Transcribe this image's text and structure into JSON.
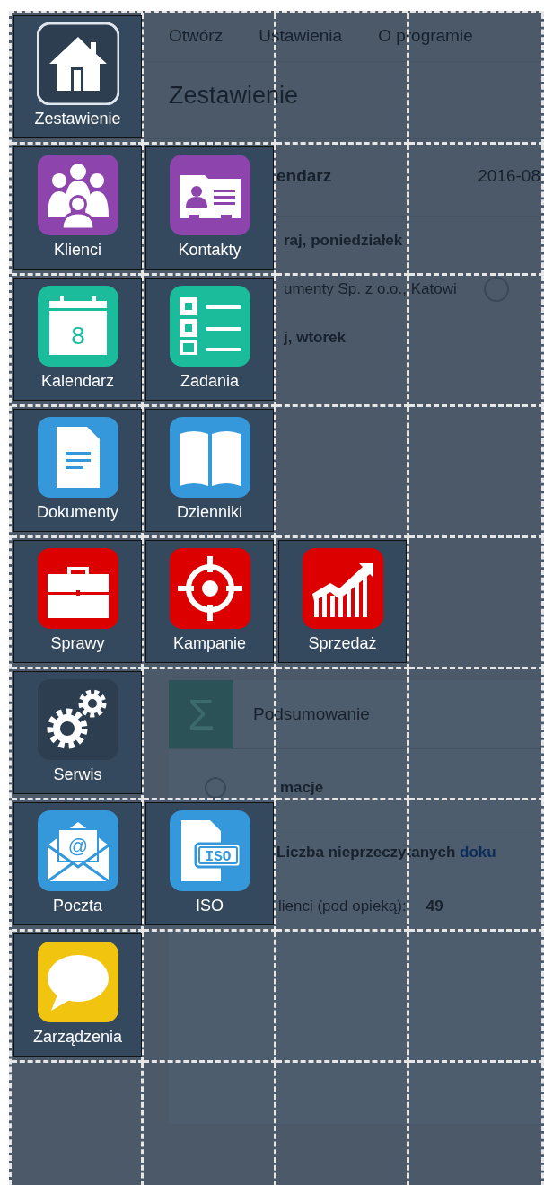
{
  "menu": [
    "Otwórz",
    "Ustawienia",
    "O programie"
  ],
  "page_title": "Zestawienie",
  "events": {
    "title": "endarz",
    "date": "2016-08",
    "items": [
      {
        "kind": "day",
        "text": "raj, poniedziałek"
      },
      {
        "kind": "entry",
        "text": "umenty Sp. z o.o., Katowi"
      },
      {
        "kind": "day",
        "text": "j, wtorek"
      }
    ]
  },
  "summary": {
    "icon": "Σ",
    "title": "Podsumowanie",
    "section": "macje",
    "unread_label": "Liczba nieprzeczytanych",
    "unread_link": "doku",
    "clients_label": "lienci (pod opieką):",
    "clients_value": "49"
  },
  "tile_rows": [
    [
      {
        "label": "Zestawienie",
        "kind": "home",
        "color": "#2c3e50"
      }
    ],
    [
      {
        "label": "Klienci",
        "kind": "people",
        "color": "#8e44ad"
      },
      {
        "label": "Kontakty",
        "kind": "contact",
        "color": "#8e44ad"
      }
    ],
    [
      {
        "label": "Kalendarz",
        "kind": "calendar",
        "color": "#1abc9c",
        "icon_text": "8"
      },
      {
        "label": "Zadania",
        "kind": "tasks",
        "color": "#1abc9c"
      }
    ],
    [
      {
        "label": "Dokumenty",
        "kind": "document",
        "color": "#3498db"
      },
      {
        "label": "Dzienniki",
        "kind": "book",
        "color": "#3498db"
      }
    ],
    [
      {
        "label": "Sprawy",
        "kind": "briefcase",
        "color": "#dd0000"
      },
      {
        "label": "Kampanie",
        "kind": "target",
        "color": "#dd0000"
      },
      {
        "label": "Sprzedaż",
        "kind": "chart",
        "color": "#dd0000"
      }
    ],
    [
      {
        "label": "Serwis",
        "kind": "gears",
        "color": "#2c3e50"
      }
    ],
    [
      {
        "label": "Poczta",
        "kind": "mail",
        "color": "#3498db",
        "icon_text": "@"
      },
      {
        "label": "ISO",
        "kind": "iso",
        "color": "#3498db",
        "icon_text": "ISO"
      }
    ],
    [
      {
        "label": "Zarządzenia",
        "kind": "bubble",
        "color": "#f1c40f"
      }
    ],
    []
  ]
}
